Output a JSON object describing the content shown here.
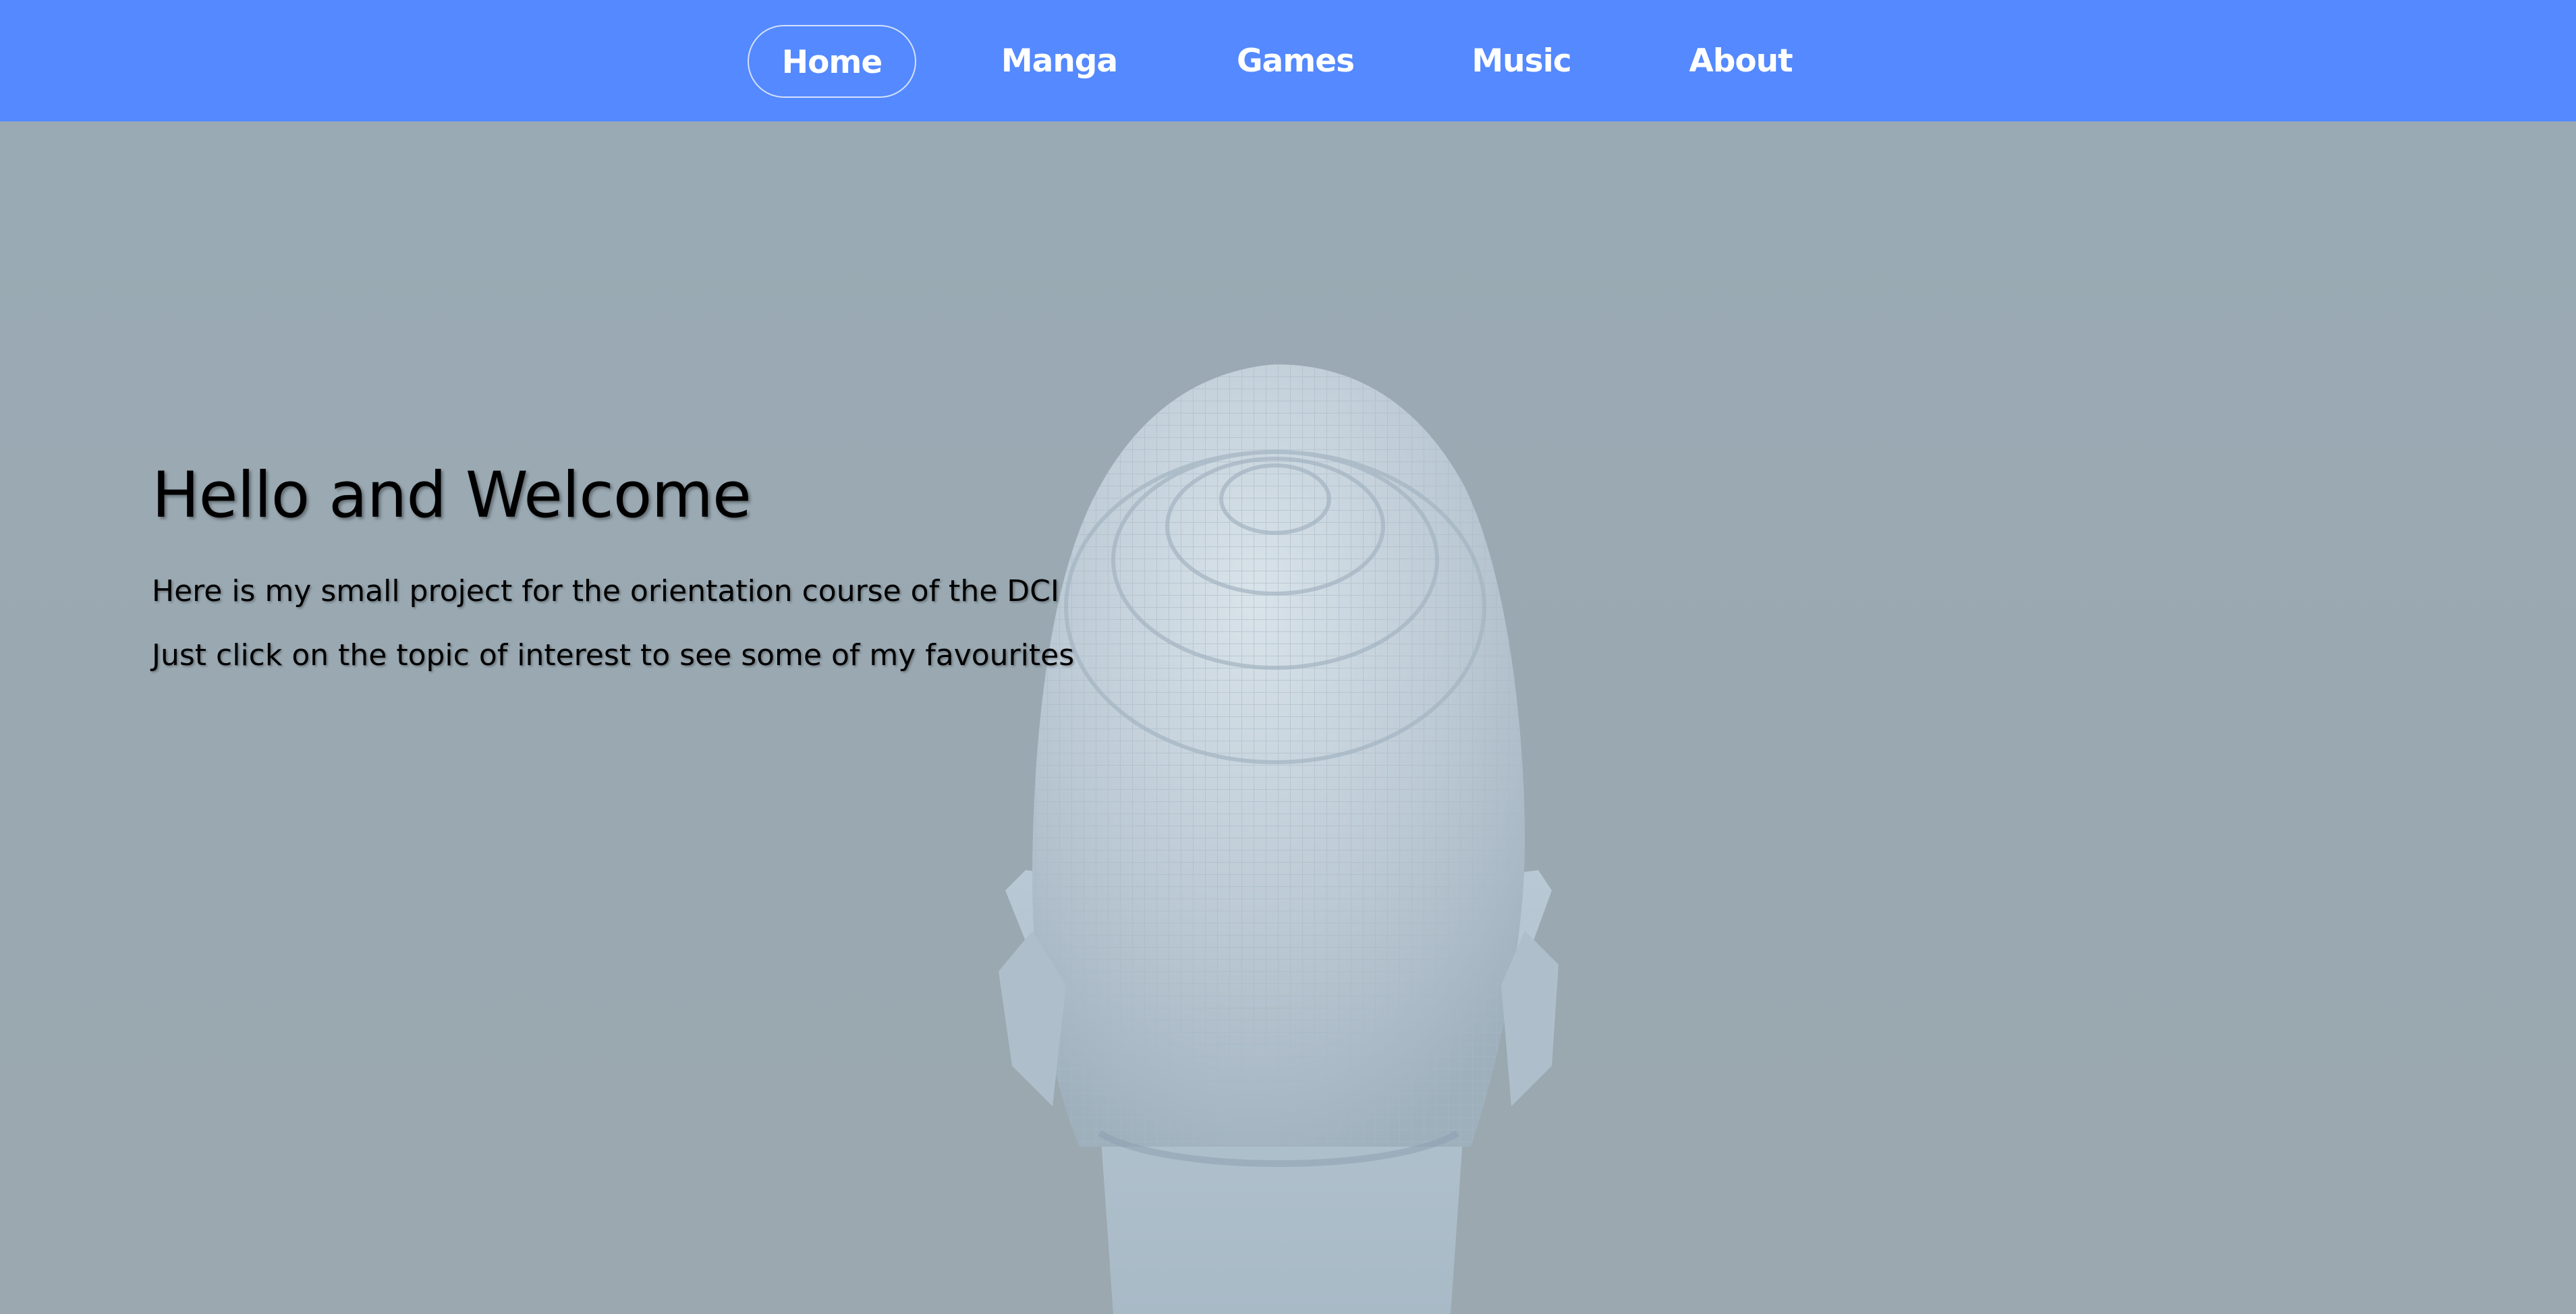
{
  "nav": {
    "items": [
      {
        "label": "Home",
        "active": true
      },
      {
        "label": "Manga",
        "active": false
      },
      {
        "label": "Games",
        "active": false
      },
      {
        "label": "Music",
        "active": false
      },
      {
        "label": "About",
        "active": false
      }
    ]
  },
  "hero": {
    "title": "Hello and Welcome",
    "line1": "Here is my small project for the orientation course of the DCI",
    "line2": "Just click on the topic of interest to see some of my favourites",
    "image_subject": "voxel-head-sculpture"
  },
  "colors": {
    "nav_background": "#5489ff",
    "nav_text": "#ffffff",
    "hero_background": "#9ba9b2",
    "hero_text": "#000000"
  }
}
